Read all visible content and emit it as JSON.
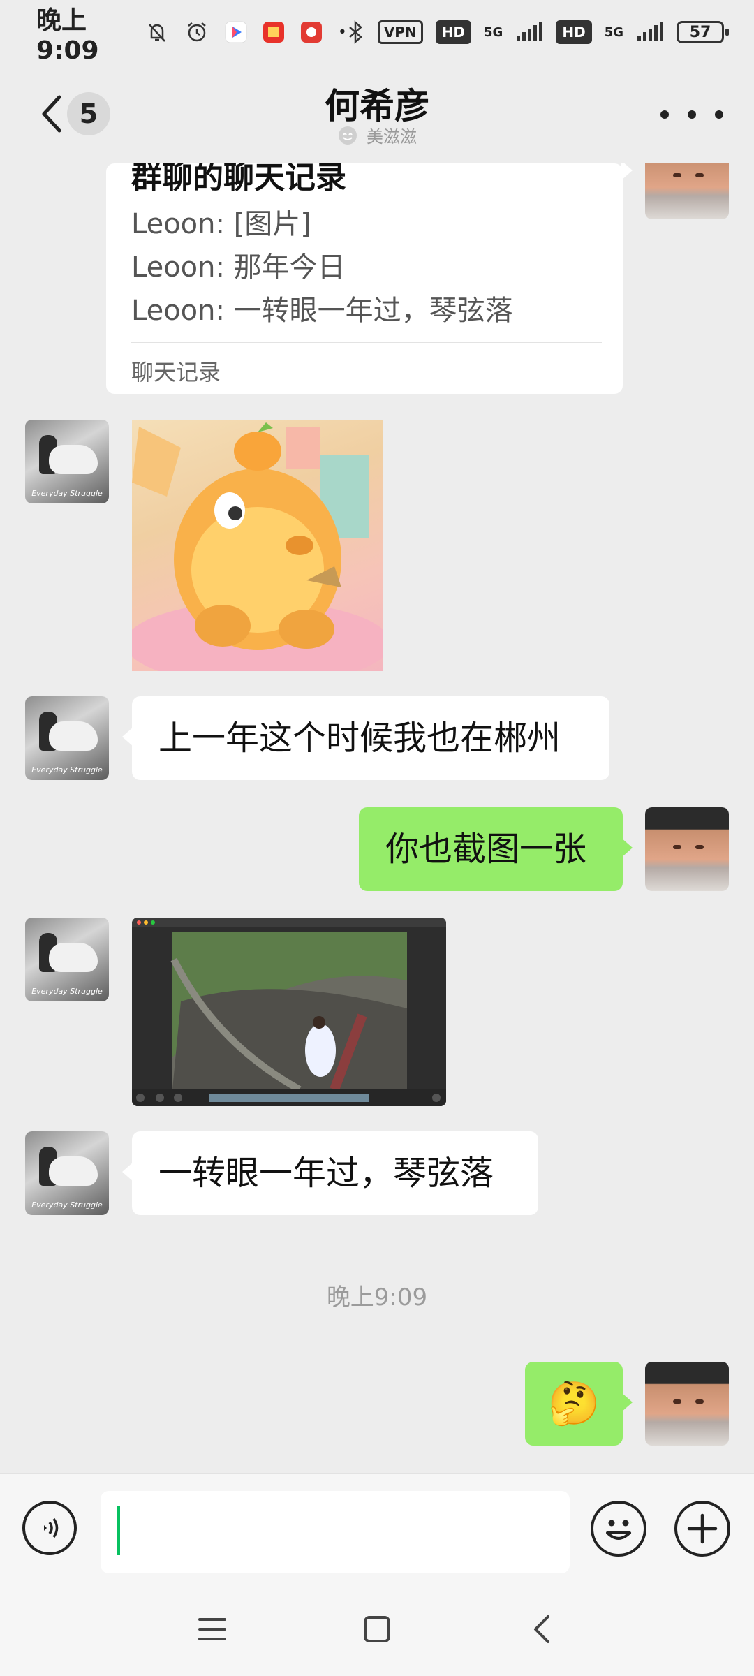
{
  "status_bar": {
    "time": "晚上9:09",
    "dot": "•",
    "vpn": "VPN",
    "hd1": "HD",
    "net1": "5G",
    "hd2": "HD",
    "net2": "5G",
    "battery": "57",
    "icons": [
      "mute-bell-icon",
      "alarm-icon",
      "video-app-icon",
      "shop-app-icon",
      "community-app-icon",
      "bluetooth-icon",
      "signal-icon"
    ]
  },
  "header": {
    "back_badge": "5",
    "title": "何希彦",
    "subtitle": "美滋滋",
    "icons": [
      "back-chevron-icon",
      "mood-face-icon",
      "more-dots-icon"
    ]
  },
  "messages": {
    "record": {
      "title": "群聊的聊天记录",
      "lines": [
        "Leoon: [图片]",
        "Leoon: 那年今日",
        "Leoon: 一转眼一年过，琴弦落"
      ],
      "footer": "聊天记录"
    },
    "text1": "上一年这个时候我也在郴州",
    "text2": "你也截图一张",
    "text3": "一转眼一年过，琴弦落",
    "timestamp": "晚上9:09",
    "emoji_reply": "🤔",
    "avatar_caption": "Everyday Struggle"
  },
  "input_bar": {
    "value": "",
    "icons": [
      "voice-icon",
      "emoji-icon",
      "plus-icon"
    ]
  },
  "nav_bar": {
    "icons": [
      "menu-icon",
      "home-icon",
      "back-icon"
    ]
  },
  "colors": {
    "background": "#ededed",
    "self_bubble": "#95ec69",
    "other_bubble": "#ffffff",
    "caret": "#07c160"
  }
}
